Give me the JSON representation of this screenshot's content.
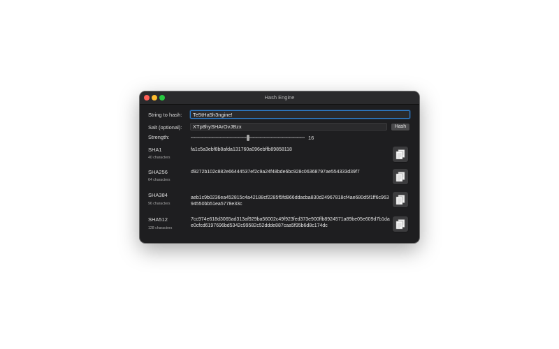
{
  "window": {
    "title": "Hash Engine"
  },
  "form": {
    "string_label": "String to hash:",
    "string_value": "Te5tHa5h3ngine!",
    "salt_label": "Salt (optional):",
    "salt_value": "XTp8hySHArOvJBzx",
    "hash_button": "Hash",
    "strength_label": "Strength:",
    "strength_value": "16",
    "strength_level": 0.5
  },
  "hashes": [
    {
      "name": "SHA1",
      "length": "40 characters",
      "value": "fa1c5a3ebf8b8afda131760a096ebffb89858118"
    },
    {
      "name": "SHA256",
      "length": "64 characters",
      "value": "d9272b102c882e66444537ef2c9a24f48bde6bc928c06368797ae554333d39f7"
    },
    {
      "name": "SHA384",
      "length": "96 characters",
      "value": "aeb1c9b0236ea452815c4a42188cf2285f5fd866ddacba830d24967818cf4ae680d5f1ff6c96394550bb51ea5778e33c"
    },
    {
      "name": "SHA512",
      "length": "128 characters",
      "value": "7cc974e618d3065ad313af929ba56002c49f923fed373e900ffb8924571a89be05e609d7b1dae0cfcd6197696bd5342c99582c52ddde887caa5f95b6d8c174dc"
    }
  ],
  "icons": {
    "copy": "copy-document-icon"
  }
}
